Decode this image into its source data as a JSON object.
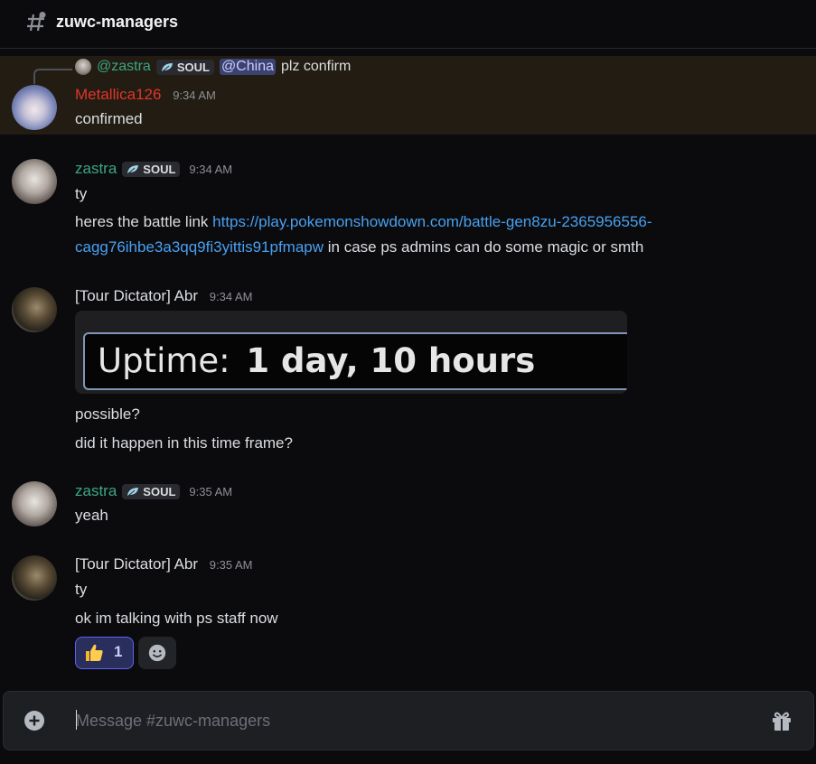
{
  "channel": {
    "title": "zuwc-managers"
  },
  "messages": {
    "m1": {
      "reply": {
        "author": "@zastra",
        "tag": "SOUL",
        "mention": "@China",
        "text": "plz confirm"
      },
      "author": "Metallica126",
      "time": "9:34 AM",
      "lines": [
        "confirmed"
      ]
    },
    "m2": {
      "author": "zastra",
      "tag": "SOUL",
      "time": "9:34 AM",
      "lines": [
        "ty"
      ],
      "link_prefix": "heres the battle link ",
      "link_line1": "https://play.pokemonshowdown.com/battle-gen8zu-2365956556-",
      "link_line2": "cagg76ihbe3a3qq9fi3yittis91pfmapw",
      "link_suffix": " in case ps admins can do some magic or smth"
    },
    "m3": {
      "author": "[Tour Dictator] Abr",
      "time": "9:34 AM",
      "embed_label": "Uptime:",
      "embed_value": "1 day, 10 hours",
      "lines": [
        "possible?",
        "did it happen in this time frame?"
      ]
    },
    "m4": {
      "author": "zastra",
      "tag": "SOUL",
      "time": "9:35 AM",
      "lines": [
        "yeah"
      ]
    },
    "m5": {
      "author": "[Tour Dictator] Abr",
      "time": "9:35 AM",
      "lines": [
        "ty",
        "ok im talking with ps staff now"
      ],
      "reaction": {
        "emoji": "thumbs-up",
        "count": "1"
      }
    }
  },
  "composer": {
    "placeholder": "Message #zuwc-managers"
  },
  "colors": {
    "accent": "#5865f2",
    "link": "#48a0f0",
    "metallica_name": "#e0352b",
    "zastra_name": "#3ca685",
    "highlight_bg": "#221c12"
  }
}
